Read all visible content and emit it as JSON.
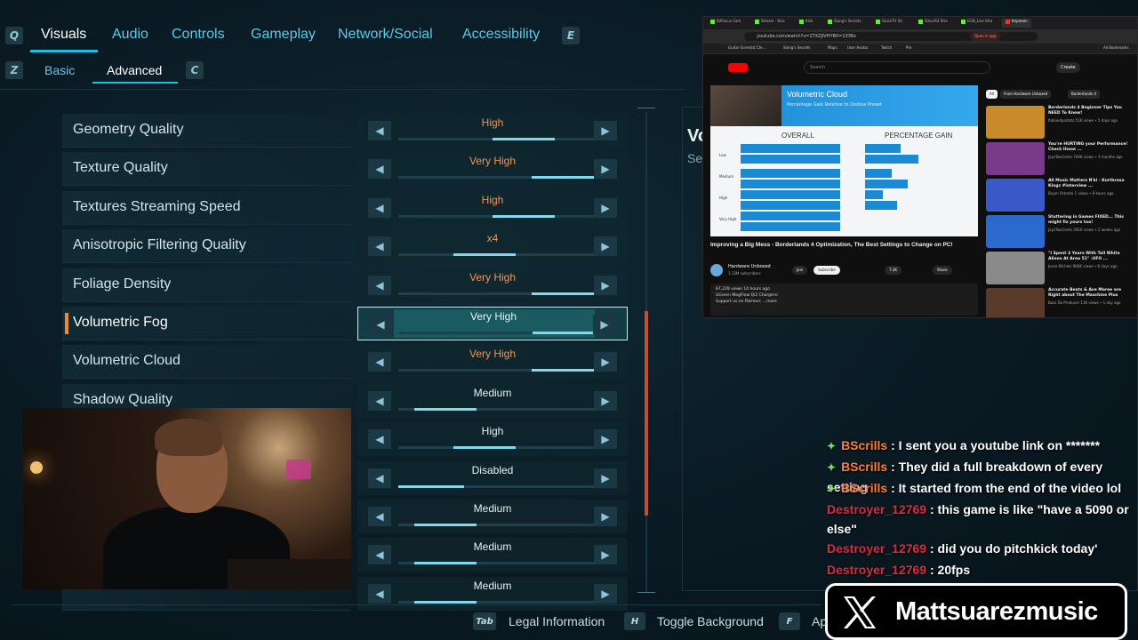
{
  "tabs": {
    "items": [
      {
        "label": "Visuals",
        "active": true
      },
      {
        "label": "Audio"
      },
      {
        "label": "Controls"
      },
      {
        "label": "Gameplay"
      },
      {
        "label": "Network/Social"
      },
      {
        "label": "Accessibility"
      }
    ],
    "prev_key": "Q",
    "next_key": "E"
  },
  "subtabs": {
    "items": [
      {
        "label": "Basic"
      },
      {
        "label": "Advanced",
        "active": true
      }
    ],
    "prev_key": "Z",
    "next_key": "C"
  },
  "settings": [
    {
      "label": "Geometry Quality",
      "value": "High",
      "value_color": "orange",
      "fill": 0.8
    },
    {
      "label": "Texture Quality",
      "value": "Very High",
      "value_color": "orange",
      "fill": 1.0
    },
    {
      "label": "Textures Streaming Speed",
      "value": "High",
      "value_color": "orange",
      "fill": 0.8
    },
    {
      "label": "Anisotropic Filtering Quality",
      "value": "x4",
      "value_color": "orange",
      "fill": 0.6
    },
    {
      "label": "Foliage Density",
      "value": "Very High",
      "value_color": "orange",
      "fill": 1.0
    },
    {
      "label": "Volumetric Fog",
      "value": "Very High",
      "value_color": "white",
      "fill": 1.0,
      "selected": true
    },
    {
      "label": "Volumetric Cloud",
      "value": "Very High",
      "value_color": "orange",
      "fill": 1.0
    },
    {
      "label": "Shadow Quality",
      "value": "Medium",
      "value_color": "white",
      "fill": 0.4
    },
    {
      "label": "",
      "value": "High",
      "value_color": "white",
      "fill": 0.6
    },
    {
      "label": "",
      "value": "Disabled",
      "value_color": "white",
      "fill": 0.0
    },
    {
      "label": "",
      "value": "Medium",
      "value_color": "white",
      "fill": 0.4
    },
    {
      "label": "",
      "value": "Medium",
      "value_color": "white",
      "fill": 0.4
    },
    {
      "label": "",
      "value": "Medium",
      "value_color": "white",
      "fill": 0.4
    }
  ],
  "detail": {
    "title": "Vo",
    "subtitle": "Se"
  },
  "footer": {
    "actions": [
      {
        "key": "Tab",
        "label": "Legal Information"
      },
      {
        "key": "H",
        "label": "Toggle Background"
      },
      {
        "key": "F",
        "label": "Ap"
      }
    ]
  },
  "browser": {
    "tabs": [
      "BitFocus Com",
      "Stream - Kick",
      "Kick",
      "Slang's Secrets",
      "GlockTV Str",
      "Silvur63 Stre",
      "EGN_Live Stre",
      "Improvin"
    ],
    "url": "youtube.com/watch?v=1TXZJlVHYB0=1336s",
    "open_app": "Open in app",
    "bookmarks": [
      "Guitar Scientist Cle...",
      "Slang's Secrets",
      "Maps",
      "User Avatar",
      "Twitch",
      "Pro",
      "All Bookmarks"
    ],
    "search_placeholder": "Search",
    "create_label": "Create",
    "video": {
      "banner_title": "Volumetric Cloud",
      "banner_sub": "Percentage Gain Relative to Dodoss Preset",
      "col_overall": "OVERALL",
      "col_gain": "PERCENTAGE GAIN",
      "rows": [
        "Low",
        "Medium",
        "High",
        "Very High"
      ],
      "caption": "Improving a Big Mess - Borderlands 4 Optimization, The Best Settings to Change on PC!",
      "channel": "Hardware Unboxed",
      "subs": "1.13M subscribers",
      "join": "Join",
      "subscribe": "Subscribe",
      "likes": "7.2K",
      "share": "Share",
      "views": "87,228 views 14 hours ago",
      "desc_line": "UGreen MagFlow Qi2 Chargers:",
      "desc_patreon": "Support us on Patreon:",
      "more": "...more"
    },
    "chips": [
      "All",
      "From Hardware Unboxed",
      "Borderlands 4"
    ],
    "recs": [
      {
        "title": "Borderlands 4 Beginner Tips You NEED To Know!",
        "meta": "Italiandprotato\n51K views • 5 days ago",
        "color": "#c98a2a"
      },
      {
        "title": "You're HURTING your Performance! Check these ...",
        "meta": "JayzTwoCents\n764K views • 3 months ago",
        "color": "#7a3a8a"
      },
      {
        "title": "All Music Matters N'ki - Kurthrosa Kingz #interview ...",
        "meta": "Bryan Ortanto\n1 views • 8 hours ago",
        "color": "#3a5ac9"
      },
      {
        "title": "Stuttering in Games FIXED... This might fix yours too!",
        "meta": "JayzTwoCents\n391K views • 2 weeks ago",
        "color": "#2a6acf"
      },
      {
        "title": "\"I Spent 3 Years With Tall White Aliens At Area 51\" -UFO ...",
        "meta": "Jesse Michels\n966K views • 6 days ago",
        "color": "#8a8a8a"
      },
      {
        "title": "Accurate Beats & Ave Moree are Right about The Maschine Plus",
        "meta": "Bass Do Producer\n11K views • 1 day ago",
        "color": "#5a3a2a"
      }
    ]
  },
  "chat": [
    {
      "user": "BScrills",
      "message": "I sent you a youtube link on *******",
      "badge": true,
      "user_color": "orange"
    },
    {
      "user": "BScrills",
      "message": "They did a full breakdown of every setting",
      "badge": true,
      "user_color": "orange"
    },
    {
      "user": "BScrills",
      "message": "It started from the end of the video lol",
      "badge": true,
      "user_color": "orange"
    },
    {
      "user": "Destroyer_12769",
      "message": "this game is like \"have a 5090 or else\"",
      "badge": false,
      "user_color": "red"
    },
    {
      "user": "Destroyer_12769",
      "message": "did you do pitchkick today'",
      "badge": false,
      "user_color": "red"
    },
    {
      "user": "Destroyer_12769",
      "message": "20fps",
      "badge": false,
      "user_color": "red"
    }
  ],
  "social": {
    "handle": "Mattsuarezmusic",
    "icon": "x-logo"
  },
  "colors": {
    "accent_cyan": "#1ec0e6",
    "value_orange": "#f0955a",
    "selected_marker": "#f08a2b",
    "chat_orange": "#ff7b3a",
    "chat_red": "#e0293d"
  }
}
